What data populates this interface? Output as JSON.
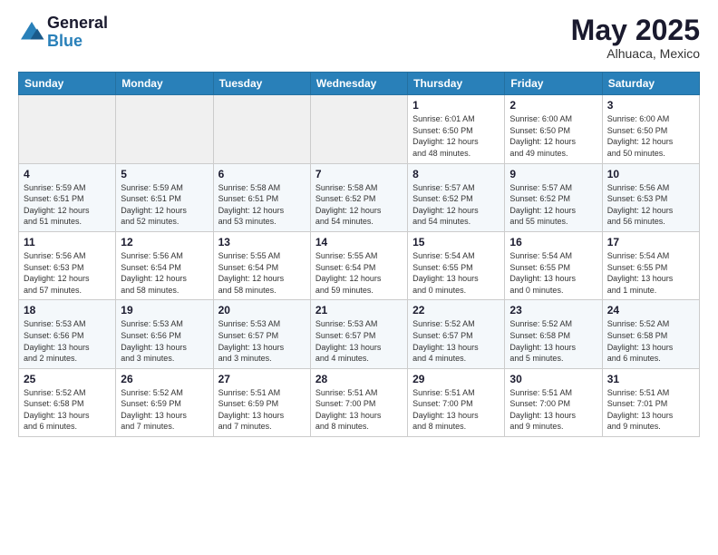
{
  "header": {
    "logo_line1": "General",
    "logo_line2": "Blue",
    "month_year": "May 2025",
    "location": "Alhuaca, Mexico"
  },
  "weekdays": [
    "Sunday",
    "Monday",
    "Tuesday",
    "Wednesday",
    "Thursday",
    "Friday",
    "Saturday"
  ],
  "weeks": [
    [
      {
        "day": "",
        "info": ""
      },
      {
        "day": "",
        "info": ""
      },
      {
        "day": "",
        "info": ""
      },
      {
        "day": "",
        "info": ""
      },
      {
        "day": "1",
        "info": "Sunrise: 6:01 AM\nSunset: 6:50 PM\nDaylight: 12 hours\nand 48 minutes."
      },
      {
        "day": "2",
        "info": "Sunrise: 6:00 AM\nSunset: 6:50 PM\nDaylight: 12 hours\nand 49 minutes."
      },
      {
        "day": "3",
        "info": "Sunrise: 6:00 AM\nSunset: 6:50 PM\nDaylight: 12 hours\nand 50 minutes."
      }
    ],
    [
      {
        "day": "4",
        "info": "Sunrise: 5:59 AM\nSunset: 6:51 PM\nDaylight: 12 hours\nand 51 minutes."
      },
      {
        "day": "5",
        "info": "Sunrise: 5:59 AM\nSunset: 6:51 PM\nDaylight: 12 hours\nand 52 minutes."
      },
      {
        "day": "6",
        "info": "Sunrise: 5:58 AM\nSunset: 6:51 PM\nDaylight: 12 hours\nand 53 minutes."
      },
      {
        "day": "7",
        "info": "Sunrise: 5:58 AM\nSunset: 6:52 PM\nDaylight: 12 hours\nand 54 minutes."
      },
      {
        "day": "8",
        "info": "Sunrise: 5:57 AM\nSunset: 6:52 PM\nDaylight: 12 hours\nand 54 minutes."
      },
      {
        "day": "9",
        "info": "Sunrise: 5:57 AM\nSunset: 6:52 PM\nDaylight: 12 hours\nand 55 minutes."
      },
      {
        "day": "10",
        "info": "Sunrise: 5:56 AM\nSunset: 6:53 PM\nDaylight: 12 hours\nand 56 minutes."
      }
    ],
    [
      {
        "day": "11",
        "info": "Sunrise: 5:56 AM\nSunset: 6:53 PM\nDaylight: 12 hours\nand 57 minutes."
      },
      {
        "day": "12",
        "info": "Sunrise: 5:56 AM\nSunset: 6:54 PM\nDaylight: 12 hours\nand 58 minutes."
      },
      {
        "day": "13",
        "info": "Sunrise: 5:55 AM\nSunset: 6:54 PM\nDaylight: 12 hours\nand 58 minutes."
      },
      {
        "day": "14",
        "info": "Sunrise: 5:55 AM\nSunset: 6:54 PM\nDaylight: 12 hours\nand 59 minutes."
      },
      {
        "day": "15",
        "info": "Sunrise: 5:54 AM\nSunset: 6:55 PM\nDaylight: 13 hours\nand 0 minutes."
      },
      {
        "day": "16",
        "info": "Sunrise: 5:54 AM\nSunset: 6:55 PM\nDaylight: 13 hours\nand 0 minutes."
      },
      {
        "day": "17",
        "info": "Sunrise: 5:54 AM\nSunset: 6:55 PM\nDaylight: 13 hours\nand 1 minute."
      }
    ],
    [
      {
        "day": "18",
        "info": "Sunrise: 5:53 AM\nSunset: 6:56 PM\nDaylight: 13 hours\nand 2 minutes."
      },
      {
        "day": "19",
        "info": "Sunrise: 5:53 AM\nSunset: 6:56 PM\nDaylight: 13 hours\nand 3 minutes."
      },
      {
        "day": "20",
        "info": "Sunrise: 5:53 AM\nSunset: 6:57 PM\nDaylight: 13 hours\nand 3 minutes."
      },
      {
        "day": "21",
        "info": "Sunrise: 5:53 AM\nSunset: 6:57 PM\nDaylight: 13 hours\nand 4 minutes."
      },
      {
        "day": "22",
        "info": "Sunrise: 5:52 AM\nSunset: 6:57 PM\nDaylight: 13 hours\nand 4 minutes."
      },
      {
        "day": "23",
        "info": "Sunrise: 5:52 AM\nSunset: 6:58 PM\nDaylight: 13 hours\nand 5 minutes."
      },
      {
        "day": "24",
        "info": "Sunrise: 5:52 AM\nSunset: 6:58 PM\nDaylight: 13 hours\nand 6 minutes."
      }
    ],
    [
      {
        "day": "25",
        "info": "Sunrise: 5:52 AM\nSunset: 6:58 PM\nDaylight: 13 hours\nand 6 minutes."
      },
      {
        "day": "26",
        "info": "Sunrise: 5:52 AM\nSunset: 6:59 PM\nDaylight: 13 hours\nand 7 minutes."
      },
      {
        "day": "27",
        "info": "Sunrise: 5:51 AM\nSunset: 6:59 PM\nDaylight: 13 hours\nand 7 minutes."
      },
      {
        "day": "28",
        "info": "Sunrise: 5:51 AM\nSunset: 7:00 PM\nDaylight: 13 hours\nand 8 minutes."
      },
      {
        "day": "29",
        "info": "Sunrise: 5:51 AM\nSunset: 7:00 PM\nDaylight: 13 hours\nand 8 minutes."
      },
      {
        "day": "30",
        "info": "Sunrise: 5:51 AM\nSunset: 7:00 PM\nDaylight: 13 hours\nand 9 minutes."
      },
      {
        "day": "31",
        "info": "Sunrise: 5:51 AM\nSunset: 7:01 PM\nDaylight: 13 hours\nand 9 minutes."
      }
    ]
  ]
}
